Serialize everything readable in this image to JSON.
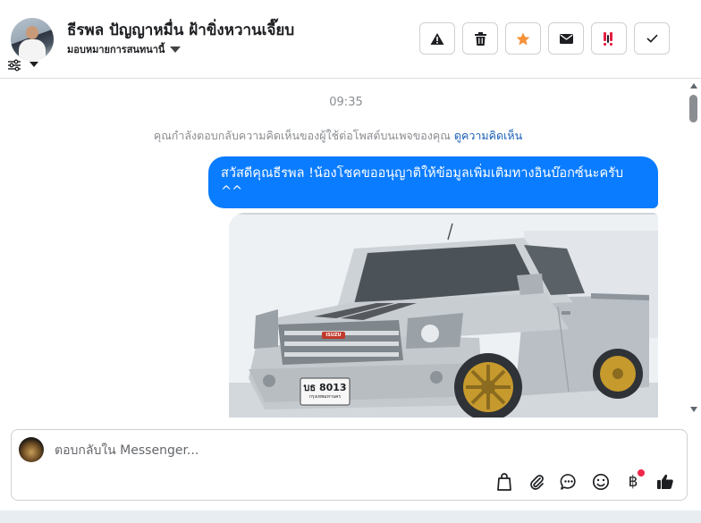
{
  "header": {
    "customer_name": "ธีรพล ปัญญาหมื่น ฝ้าขิ่งหวานเจี๊ยบ",
    "assign_label": "มอบหมายการสนทนานี้",
    "action_icons": [
      "warning-icon",
      "trash-icon",
      "star-icon",
      "envelope-icon",
      "spam-icon",
      "check-icon"
    ],
    "colors": {
      "star": "#f7923a",
      "spam": "#e41e3f"
    }
  },
  "conversation": {
    "time": "09:35",
    "notice_text": "คุณกำลังตอบกลับความคิดเห็นของผู้ใช้ต่อโพสต์บนเพจของคุณ",
    "notice_link": "ดูความคิดเห็น",
    "messages": [
      {
        "text": "สวัสดีคุณธีรพล !น้องโชคขออนุญาติให้ข้อมูลเพิ่มเติมทางอินบ๊อกซ์นะครับ ^^",
        "bubble_color": "#0a7cff"
      }
    ],
    "photo": {
      "plate_line1": "บธ 8013",
      "plate_line2": "กรุงเทพมหานคร",
      "grille_badge": "ISUZU"
    }
  },
  "composer": {
    "placeholder": "ตอบกลับใน Messenger...",
    "tools": [
      "shopping-bag-icon",
      "paperclip-icon",
      "saved-reply-icon",
      "emoji-icon",
      "baht-icon",
      "thumbs-up-icon"
    ],
    "baht_symbol": "฿",
    "notification_color": "#f02849"
  }
}
